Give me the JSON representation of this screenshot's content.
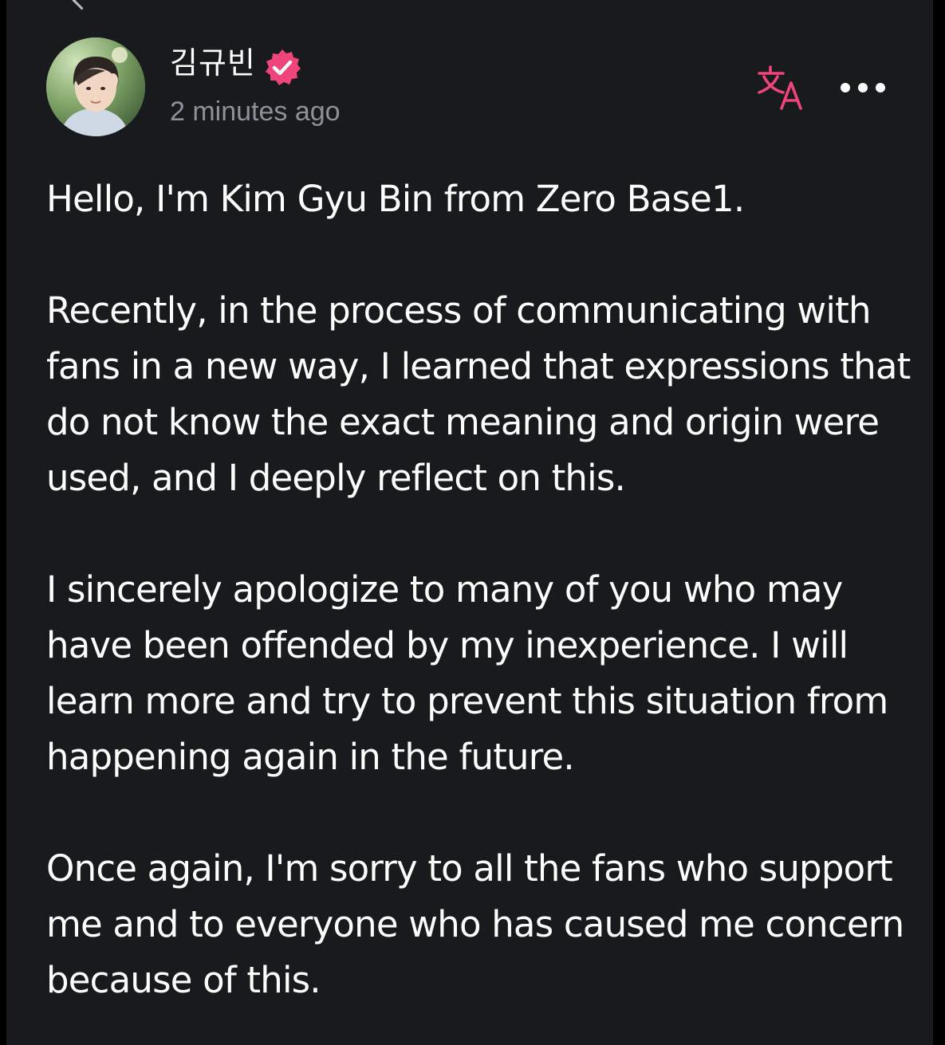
{
  "post": {
    "author": {
      "name": "김규빈",
      "verified_icon": "verified-badge-icon",
      "timestamp": "2 minutes ago"
    },
    "actions": {
      "translate_icon": "translate-icon",
      "more_icon": "more-options-icon"
    },
    "colors": {
      "accent": "#f0457a",
      "background": "#181a1e",
      "text": "#ffffff",
      "muted": "#8e9199"
    },
    "paragraphs": [
      "Hello, I'm Kim Gyu Bin from Zero Base1.",
      "Recently, in the process of communicating with fans in a new way, I learned that expressions that do not know the exact meaning and origin were used, and I deeply reflect on this.",
      "I sincerely apologize to many of you who may have been offended by my inexperience. I will learn more and try to prevent this situation from happening again in the future.",
      "Once again, I'm sorry to all the fans who support me and to everyone who has caused me concern because of this."
    ]
  }
}
